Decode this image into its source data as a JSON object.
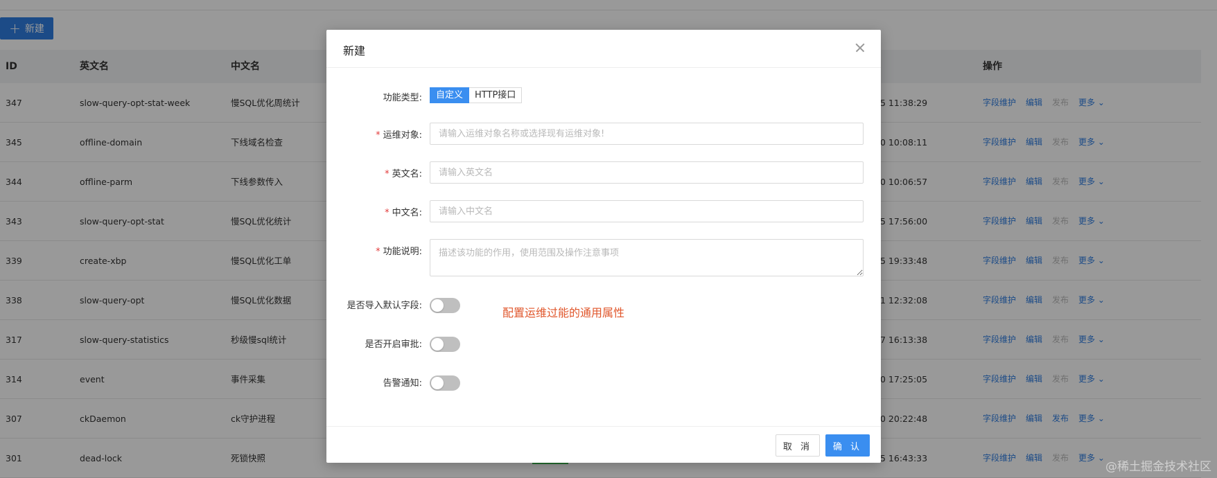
{
  "toolbar": {
    "new_label": "新建"
  },
  "table": {
    "headers": [
      "ID",
      "英文名",
      "中文名",
      "操作"
    ],
    "rows": [
      {
        "id": "347",
        "en": "slow-query-opt-stat-week",
        "cn": "慢SQL优化周统计",
        "time": "5 11:38:29",
        "publish_enabled": false
      },
      {
        "id": "345",
        "en": "offline-domain",
        "cn": "下线域名检查",
        "time": "0 10:08:11",
        "publish_enabled": false
      },
      {
        "id": "344",
        "en": "offline-parm",
        "cn": "下线参数传入",
        "time": "0 10:06:57",
        "publish_enabled": false
      },
      {
        "id": "343",
        "en": "slow-query-opt-stat",
        "cn": "慢SQL优化统计",
        "time": "5 17:56:00",
        "publish_enabled": false
      },
      {
        "id": "339",
        "en": "create-xbp",
        "cn": "慢SQL优化工单",
        "time": "5 19:33:48",
        "publish_enabled": false
      },
      {
        "id": "338",
        "en": "slow-query-opt",
        "cn": "慢SQL优化数据",
        "time": "1 12:32:08",
        "publish_enabled": false
      },
      {
        "id": "317",
        "en": "slow-query-statistics",
        "cn": "秒级慢sql统计",
        "time": "7 16:13:38",
        "publish_enabled": false
      },
      {
        "id": "314",
        "en": "event",
        "cn": "事件采集",
        "time": "0 17:25:05",
        "publish_enabled": false
      },
      {
        "id": "307",
        "en": "ckDaemon",
        "cn": "ck守护进程",
        "time": "0 20:22:48",
        "publish_enabled": true
      },
      {
        "id": "301",
        "en": "dead-lock",
        "cn": "死锁快照",
        "time": "5 16:43:33",
        "publish_enabled": false
      }
    ],
    "ops": {
      "fields": "字段维护",
      "edit": "编辑",
      "publish": "发布",
      "more": "更多"
    }
  },
  "modal": {
    "title": "新建",
    "type_label": "功能类型",
    "type_options": [
      "自定义",
      "HTTP接口"
    ],
    "target_label": "运维对象",
    "target_placeholder": "请输入运维对象名称或选择现有运维对象!",
    "en_label": "英文名",
    "en_placeholder": "请输入英文名",
    "cn_label": "中文名",
    "cn_placeholder": "请输入中文名",
    "desc_label": "功能说明",
    "desc_placeholder": "描述该功能的作用，使用范围及操作注意事项",
    "import_label": "是否导入默认字段",
    "approval_label": "是否开启审批",
    "alert_label": "告警通知",
    "annotation": "配置运维过能的通用属性",
    "cancel": "取 消",
    "ok": "确 认"
  },
  "watermark": "@稀土掘金技术社区",
  "colors": {
    "primary": "#3a8ef0",
    "annotation": "#e0562b",
    "required": "#e23b3b"
  }
}
